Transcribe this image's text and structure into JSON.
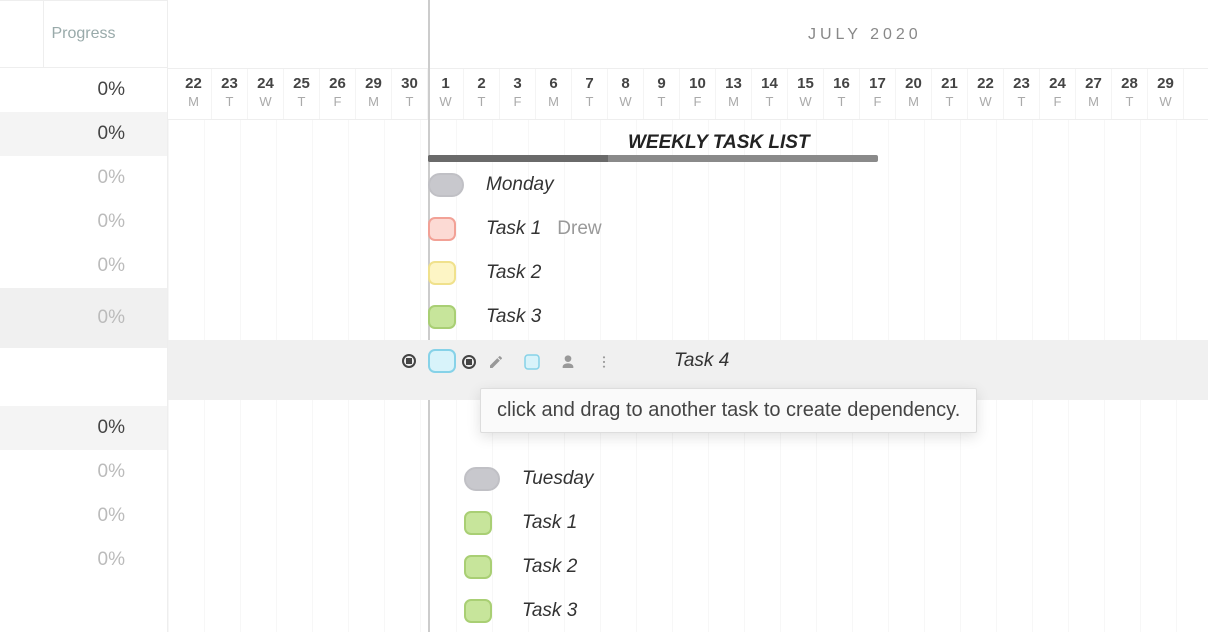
{
  "sidebar": {
    "header": "Progress",
    "rows": [
      {
        "value": "0%",
        "style": "dark"
      },
      {
        "value": "0%",
        "style": "dark",
        "gray": true
      },
      {
        "value": "0%",
        "style": "faded"
      },
      {
        "value": "0%",
        "style": "faded"
      },
      {
        "value": "0%",
        "style": "faded"
      },
      {
        "value": "0%",
        "style": "faded",
        "highlight": true
      },
      {
        "value": "",
        "style": "blank"
      },
      {
        "value": "0%",
        "style": "dark",
        "gray": true
      },
      {
        "value": "0%",
        "style": "faded"
      },
      {
        "value": "0%",
        "style": "faded"
      },
      {
        "value": "0%",
        "style": "faded"
      }
    ]
  },
  "month": "JULY 2020",
  "days": [
    {
      "n": "22",
      "d": "M"
    },
    {
      "n": "23",
      "d": "T"
    },
    {
      "n": "24",
      "d": "W"
    },
    {
      "n": "25",
      "d": "T"
    },
    {
      "n": "26",
      "d": "F"
    },
    {
      "n": "29",
      "d": "M"
    },
    {
      "n": "30",
      "d": "T"
    },
    {
      "n": "1",
      "d": "W"
    },
    {
      "n": "2",
      "d": "T"
    },
    {
      "n": "3",
      "d": "F"
    },
    {
      "n": "6",
      "d": "M"
    },
    {
      "n": "7",
      "d": "T"
    },
    {
      "n": "8",
      "d": "W"
    },
    {
      "n": "9",
      "d": "T"
    },
    {
      "n": "10",
      "d": "F"
    },
    {
      "n": "13",
      "d": "M"
    },
    {
      "n": "14",
      "d": "T"
    },
    {
      "n": "15",
      "d": "W"
    },
    {
      "n": "16",
      "d": "T"
    },
    {
      "n": "17",
      "d": "F"
    },
    {
      "n": "20",
      "d": "M"
    },
    {
      "n": "21",
      "d": "T"
    },
    {
      "n": "22",
      "d": "W"
    },
    {
      "n": "23",
      "d": "T"
    },
    {
      "n": "24",
      "d": "F"
    },
    {
      "n": "27",
      "d": "M"
    },
    {
      "n": "28",
      "d": "T"
    },
    {
      "n": "29",
      "d": "W"
    }
  ],
  "header_title": "WEEKLY TASK LIST",
  "groups": [
    {
      "name": "Monday",
      "chip_color": "gray",
      "tasks": [
        {
          "label": "Task 1",
          "color": "red",
          "assignee": "Drew"
        },
        {
          "label": "Task 2",
          "color": "yellow"
        },
        {
          "label": "Task 3",
          "color": "green"
        },
        {
          "label": "Task 4",
          "color": "blue",
          "selected": true
        }
      ]
    },
    {
      "name": "Tuesday",
      "chip_color": "gray",
      "tasks": [
        {
          "label": "Task 1",
          "color": "green"
        },
        {
          "label": "Task 2",
          "color": "green"
        },
        {
          "label": "Task 3",
          "color": "green"
        }
      ]
    }
  ],
  "tooltip": "click and drag to another task to create dependency.",
  "icons": {
    "edit": "pencil-icon",
    "color": "color-swatch-icon",
    "assign": "person-icon",
    "more": "more-vertical-icon",
    "dep": "dependency-handle-icon"
  }
}
